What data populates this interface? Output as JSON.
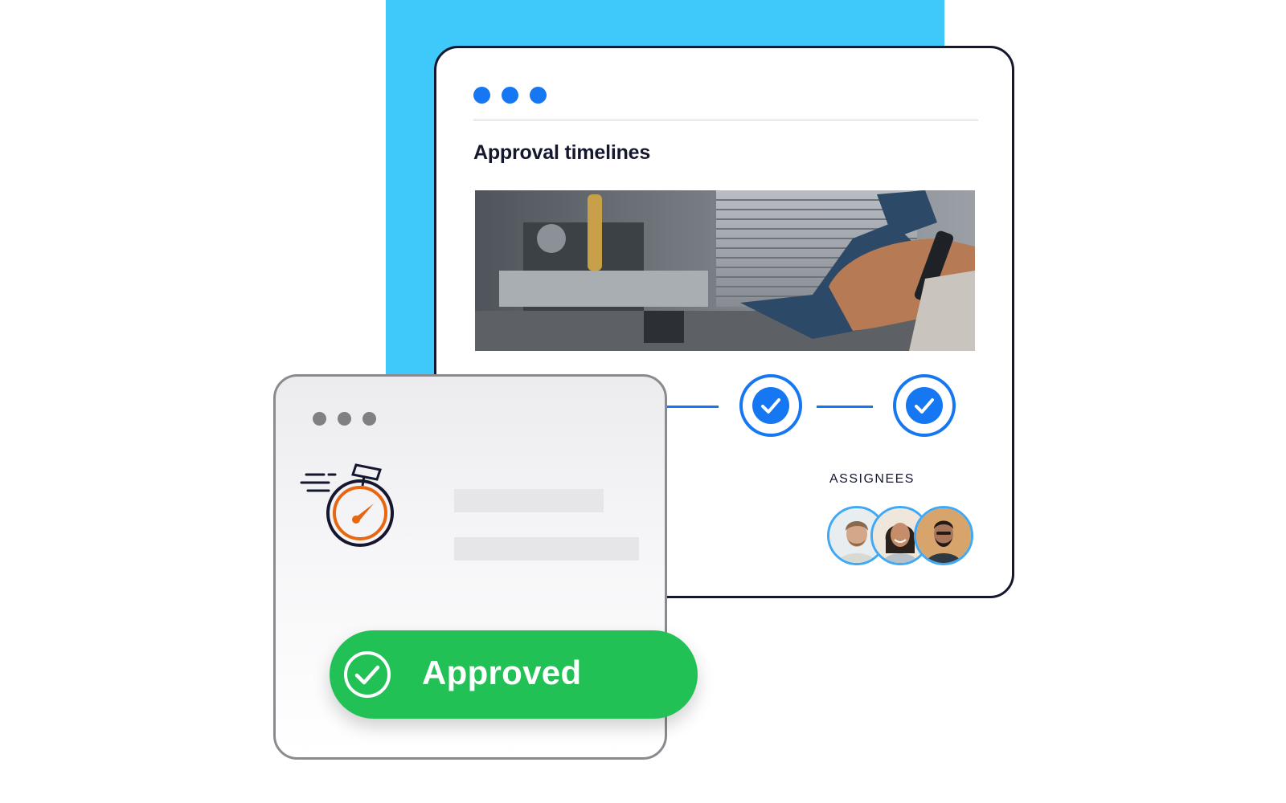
{
  "colors": {
    "accent": "#1677f2",
    "backdrop": "#3fc8fa",
    "success": "#22c156",
    "ink": "#15172e",
    "stopwatch": "#e8660f"
  },
  "main_window": {
    "title": "Approval timelines",
    "window_controls": [
      "dot",
      "dot",
      "dot"
    ],
    "photo_description_icon": "photo-icon",
    "timeline": {
      "completed_steps": 2,
      "step_icon": "check-icon"
    },
    "assignees": {
      "label": "ASSIGNEES",
      "avatars": [
        "avatar-1",
        "avatar-2",
        "avatar-3"
      ]
    }
  },
  "sub_window": {
    "window_controls": [
      "dot",
      "dot",
      "dot"
    ],
    "icon": "stopwatch-icon"
  },
  "status_pill": {
    "label": "Approved",
    "icon": "check-circle-icon"
  }
}
